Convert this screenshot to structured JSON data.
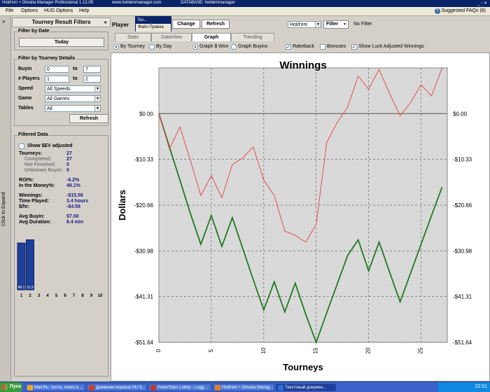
{
  "window": {
    "title": "Hold'em + Omaha Manager Professional 1.12.09",
    "website": "www.holdemmanager.com",
    "database": "DATABASE: holdemmanager"
  },
  "menu": [
    "File",
    "Options",
    "HUD Options",
    "Help"
  ],
  "help": {
    "faqs": "Suggested FAQs (8)"
  },
  "sidebar": {
    "expand_arrow": "»",
    "expand_label": "Click to Expand"
  },
  "left": {
    "title": "Tourney Result Filters",
    "collapse": "«",
    "filter_by_date": {
      "title": "Filter by Date",
      "button": "Today"
    },
    "filter_by_details": {
      "title": "Filter by Tourney Details",
      "buyin": {
        "label": "Buyin",
        "from": "0",
        "to_label": "to",
        "to": "7"
      },
      "players": {
        "label": "# Players",
        "from": "1",
        "to_label": "to",
        "to": "2"
      },
      "speed": {
        "label": "Speed",
        "value": "All Speeds"
      },
      "game": {
        "label": "Game",
        "value": "All Games"
      },
      "tables": {
        "label": "Tables",
        "value": "All"
      }
    },
    "refresh": "Refresh",
    "filtered": {
      "title": "Filtered Data",
      "show_sev": "Show $EV adjusted",
      "stats": [
        {
          "label": "Tourneys:",
          "value": "27"
        },
        {
          "label": "Completed:",
          "value": "27"
        },
        {
          "label": "Not Finished:",
          "value": "0"
        },
        {
          "label": "Unknown Buyin:",
          "value": "0"
        },
        {
          "label": "ROI%:",
          "value": "-8.2%"
        },
        {
          "label": "In the Money%:",
          "value": "48.1%"
        },
        {
          "label": "Winnings:",
          "value": "-$15.58"
        },
        {
          "label": "Time Played:",
          "value": "3.4 hours"
        },
        {
          "label": "$/hr:",
          "value": "-$4.56"
        },
        {
          "label": "Avg Buyin:",
          "value": "$7.00"
        },
        {
          "label": "Avg Duration:",
          "value": "8.4 min"
        }
      ],
      "placings": {
        "labels": [
          "1",
          "2",
          "3",
          "4",
          "5",
          "6",
          "7",
          "8",
          "9",
          "10"
        ],
        "bar_labels": [
          "48.1",
          "51.9"
        ],
        "values": [
          13,
          14,
          0,
          0,
          0,
          0,
          0,
          0,
          0,
          0
        ]
      }
    }
  },
  "toolbar": {
    "player_label": "Player",
    "change": "Change",
    "refresh": "Refresh",
    "game_select": "Hold'em",
    "filter": "Filter",
    "no_filter": "No Filter"
  },
  "popup": {
    "title": "Tex...",
    "menu": "Файл  Правка"
  },
  "tabs": [
    "Stats",
    "DataView",
    "Graph",
    "Trending"
  ],
  "active_tab": "Graph",
  "options": [
    {
      "label": "By Tourney",
      "type": "radio",
      "checked": true
    },
    {
      "label": "By Day",
      "type": "radio",
      "checked": false
    },
    {
      "label": "Graph $ Won",
      "type": "radio",
      "checked": true
    },
    {
      "label": "Graph Buyins",
      "type": "radio",
      "checked": false
    },
    {
      "label": "Rakeback",
      "type": "check",
      "checked": true
    },
    {
      "label": "Bonuses",
      "type": "check",
      "checked": false
    },
    {
      "label": "Show Luck Adjusted Winnings",
      "type": "check",
      "checked": true
    }
  ],
  "chart_data": {
    "type": "line",
    "title": "Winnings",
    "xlabel": "Tourneys",
    "ylabel": "Dollars",
    "xlim": [
      0,
      27.5
    ],
    "ylim": [
      -51.64,
      10.33
    ],
    "yticks": [
      0,
      -10.33,
      -20.66,
      -30.98,
      -41.31,
      -51.64
    ],
    "ytick_labels": [
      "$0.00",
      "-$10.33",
      "-$20.66",
      "-$30.98",
      "-$41.31",
      "-$51.64"
    ],
    "xticks": [
      0,
      5,
      10,
      15,
      20,
      25
    ],
    "series": [
      {
        "color": "#1f7a1f",
        "x": [
          0,
          1,
          2,
          3,
          4,
          5,
          6,
          7,
          8,
          9,
          10,
          11,
          12,
          13,
          14,
          15,
          16,
          17,
          18,
          19,
          20,
          21,
          22,
          23,
          24,
          25,
          26,
          27
        ],
        "y": [
          0,
          -7.5,
          -15.0,
          -22.5,
          -29.5,
          -23.0,
          -30.0,
          -23.5,
          -30.5,
          -37.5,
          -44.3,
          -38.0,
          -44.8,
          -38.3,
          -45.3,
          -51.64,
          -45.0,
          -38.5,
          -32.0,
          -28.5,
          -35.5,
          -29.0,
          -35.8,
          -42.5,
          -36.0,
          -29.5,
          -23.0,
          -16.6
        ]
      },
      {
        "color": "#e05050",
        "x": [
          0,
          1,
          2,
          3,
          4,
          5,
          6,
          7,
          8,
          9,
          10,
          11,
          12,
          13,
          14,
          15,
          16,
          17,
          18,
          19,
          20,
          21,
          22,
          23,
          24,
          25,
          26,
          27
        ],
        "y": [
          0,
          -8.0,
          -3.0,
          -10.5,
          -18.5,
          -14.0,
          -19.0,
          -11.5,
          -10.0,
          -7.5,
          -15.0,
          -18.5,
          -26.5,
          -27.5,
          -29.0,
          -25.0,
          -6.5,
          -2.0,
          1.5,
          8.5,
          5.5,
          10.0,
          4.5,
          -0.5,
          2.5,
          6.5,
          4.0,
          10.3
        ]
      }
    ]
  },
  "taskbar": {
    "start": "Пуск",
    "items": [
      {
        "label": "Mail.Ru: почта, поиск в ...",
        "color": "#f5a623"
      },
      {
        "label": "Дневники игроков HU S...",
        "color": "#d0402a"
      },
      {
        "label": "PokerStars Lobby - Logg...",
        "color": "#c0392b"
      },
      {
        "label": "Hold'em + Omaha Manag...",
        "color": "#e67e22"
      },
      {
        "label": "Текстовый докумен...",
        "color": "#2d6cdf",
        "active": true
      }
    ],
    "lang": "RU",
    "clock": "22:51"
  }
}
